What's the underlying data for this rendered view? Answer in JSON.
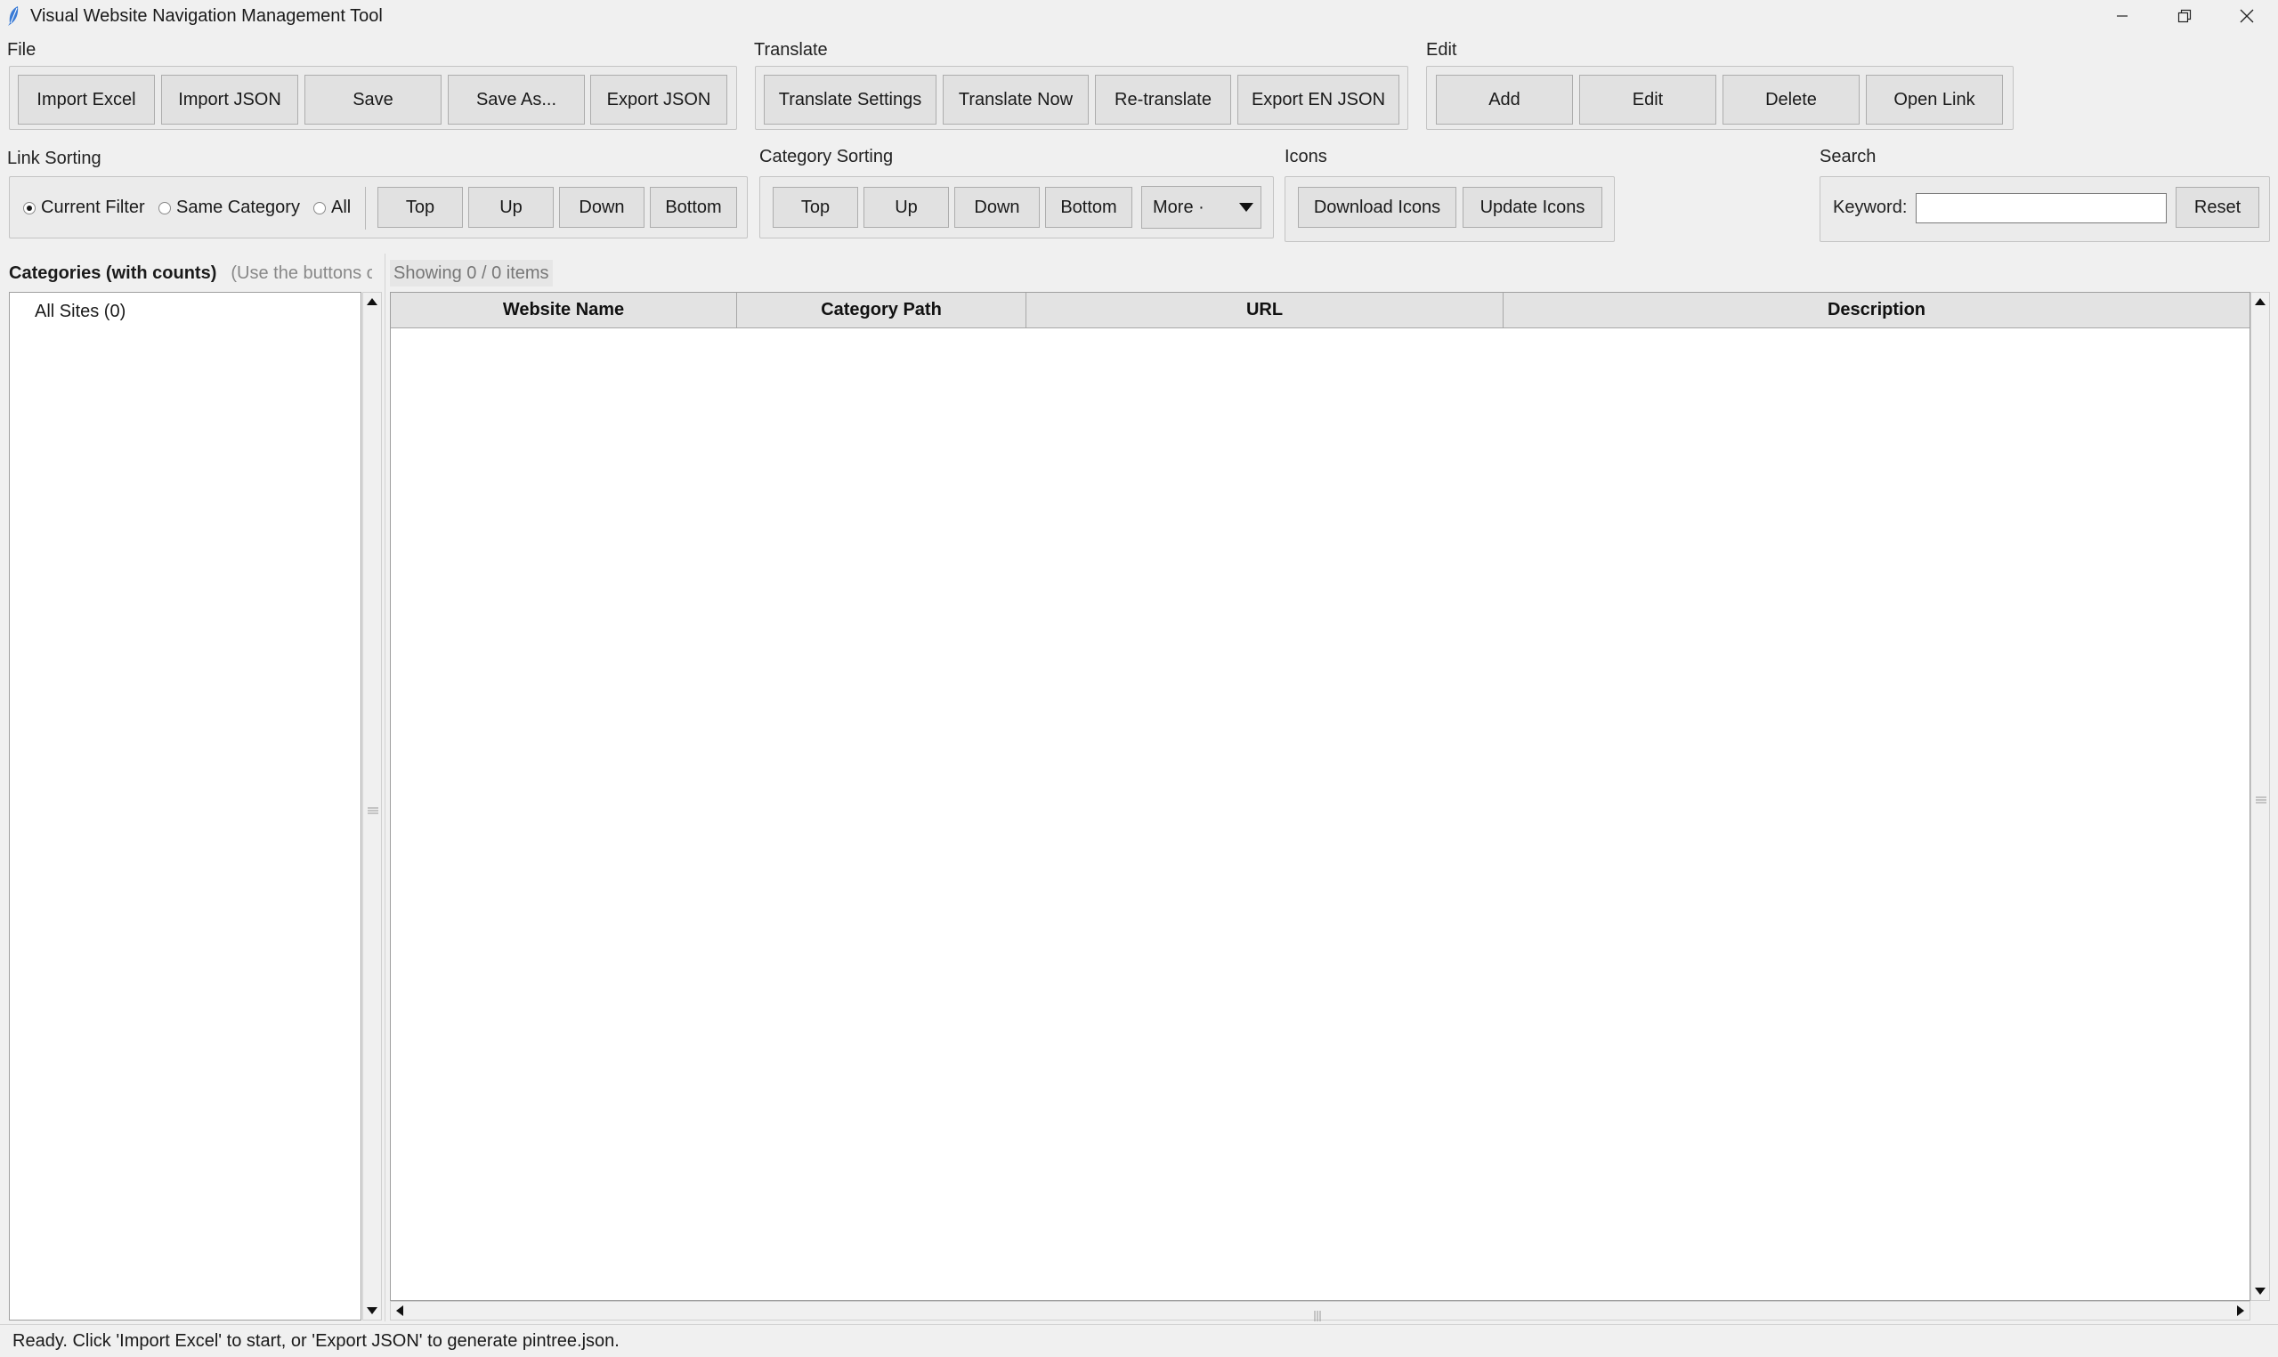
{
  "window": {
    "title": "Visual Website Navigation Management Tool",
    "app_icon": "feather-icon",
    "controls": [
      "minimize-icon",
      "restore-icon",
      "close-icon"
    ]
  },
  "file_group": {
    "label": "File",
    "buttons": [
      "Import Excel",
      "Import JSON",
      "Save",
      "Save As...",
      "Export JSON"
    ]
  },
  "translate_group": {
    "label": "Translate",
    "buttons": [
      "Translate Settings",
      "Translate Now",
      "Re-translate",
      "Export EN JSON"
    ]
  },
  "edit_group": {
    "label": "Edit",
    "buttons": [
      "Add",
      "Edit",
      "Delete",
      "Open Link"
    ]
  },
  "link_sorting": {
    "label": "Link Sorting",
    "radios": [
      {
        "label": "Current Filter",
        "selected": true
      },
      {
        "label": "Same Category",
        "selected": false
      },
      {
        "label": "All",
        "selected": false
      }
    ],
    "buttons": [
      "Top",
      "Up",
      "Down",
      "Bottom"
    ]
  },
  "category_sorting": {
    "label": "Category Sorting",
    "buttons": [
      "Top",
      "Up",
      "Down",
      "Bottom"
    ],
    "more": "More ·"
  },
  "icons_group": {
    "label": "Icons",
    "buttons": [
      "Download Icons",
      "Update Icons"
    ]
  },
  "search": {
    "label": "Search",
    "keyword_label": "Keyword:",
    "keyword_value": "",
    "reset": "Reset"
  },
  "categories_pane": {
    "title": "Categories (with counts)",
    "hint": "(Use the buttons o",
    "items": [
      "All Sites (0)"
    ]
  },
  "table": {
    "showing": "Showing 0 / 0 items",
    "columns": [
      "Website Name",
      "Category Path",
      "URL",
      "Description"
    ],
    "rows": []
  },
  "status": "Ready. Click 'Import Excel' to start, or 'Export JSON' to generate pintree.json."
}
